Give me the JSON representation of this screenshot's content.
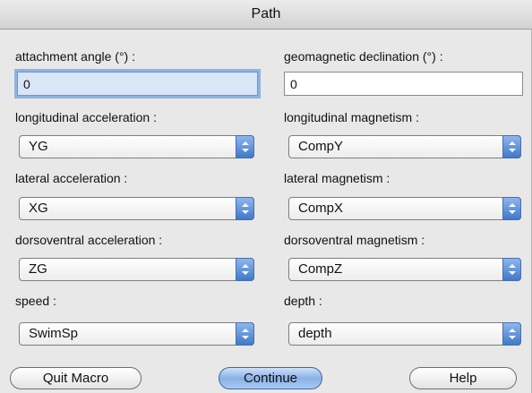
{
  "window": {
    "title": "Path"
  },
  "fields": {
    "attachment_angle": {
      "label": "attachment angle (°) :",
      "value": "0"
    },
    "geomagnetic_declination": {
      "label": "geomagnetic declination (°) :",
      "value": "0"
    }
  },
  "selects": {
    "longitudinal_acceleration": {
      "label": "longitudinal acceleration :",
      "value": "YG"
    },
    "longitudinal_magnetism": {
      "label": "longitudinal magnetism :",
      "value": "CompY"
    },
    "lateral_acceleration": {
      "label": "lateral acceleration :",
      "value": "XG"
    },
    "lateral_magnetism": {
      "label": "lateral magnetism :",
      "value": "CompX"
    },
    "dorsoventral_acceleration": {
      "label": "dorsoventral acceleration :",
      "value": "ZG"
    },
    "dorsoventral_magnetism": {
      "label": "dorsoventral magnetism :",
      "value": "CompZ"
    },
    "speed": {
      "label": "speed :",
      "value": "SwimSp"
    },
    "depth": {
      "label": "depth :",
      "value": "depth"
    }
  },
  "buttons": {
    "quit": "Quit Macro",
    "continue": "Continue",
    "help": "Help"
  },
  "colors": {
    "accent": "#3f79c9",
    "focus": "#8fb3e3"
  }
}
